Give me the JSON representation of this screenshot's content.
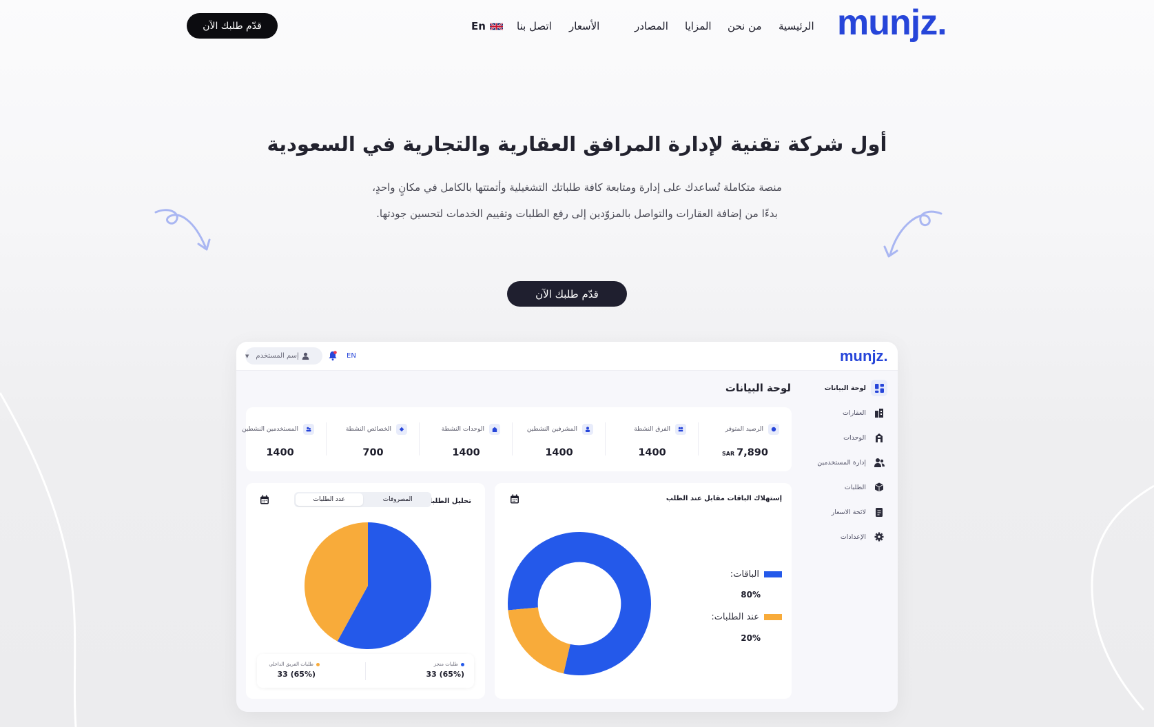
{
  "nav": {
    "logo_text": "munjz.",
    "items": [
      "الرئيسية",
      "من نحن",
      "المزايا",
      "المصادر",
      "الأسعار",
      "اتصل بنا"
    ],
    "lang_label": "En",
    "cta": "قدّم طلبك الآن"
  },
  "hero": {
    "title": "أول شركة تقنية لإدارة المرافق العقارية والتجارية في السعودية",
    "sub1": "منصة  متكاملة تُساعدك على إدارة ومتابعة كافة طلباتك التشغيلية وأتمتتها بالكامل في مكانٍ واحدٍ،",
    "sub2": "بدءًا من إضافة العقارات والتواصل بالمزوّدين إلى رفع الطلبات وتقييم الخدمات لتحسين جودتها.",
    "cta": "قدّم طلبك الآن"
  },
  "dashboard": {
    "logo_text": "munjz.",
    "lang": "EN",
    "user_placeholder": "إسم المستخدم",
    "page_title": "لوحة البيانات",
    "sidebar": [
      {
        "label": "لوحة البيانات",
        "icon": "dashboard-icon",
        "active": true
      },
      {
        "label": "العقارات",
        "icon": "buildings-icon",
        "active": false
      },
      {
        "label": "الوحدات",
        "icon": "building-icon",
        "active": false
      },
      {
        "label": "إدارة المستخدمين",
        "icon": "users-icon",
        "active": false
      },
      {
        "label": "الطلبات",
        "icon": "box-icon",
        "active": false
      },
      {
        "label": "لائحة الاسعار",
        "icon": "price-list-icon",
        "active": false
      },
      {
        "label": "الإعدادات",
        "icon": "gear-icon",
        "active": false
      }
    ],
    "stats": [
      {
        "label": "الرصيد المتوفر",
        "value": "7,890",
        "unit": "SAR",
        "icon": "wallet-icon"
      },
      {
        "label": "الفرق النشطة",
        "value": "1400",
        "unit": "",
        "icon": "team-icon"
      },
      {
        "label": "المشرفين النشطين",
        "value": "1400",
        "unit": "",
        "icon": "supervisor-icon"
      },
      {
        "label": "الوحدات النشطة",
        "value": "1400",
        "unit": "",
        "icon": "home-icon"
      },
      {
        "label": "الخصائص النشطة",
        "value": "700",
        "unit": "",
        "icon": "property-icon"
      },
      {
        "label": "المستخدمين النشطين",
        "value": "1400",
        "unit": "",
        "icon": "active-users-icon"
      }
    ],
    "packages_card": {
      "title": "إستهلاك الباقات مقابل عند الطلب",
      "legend": [
        {
          "label": "الباقات:",
          "value": "80%",
          "color": "#2459ea"
        },
        {
          "label": "عند الطلبات:",
          "value": "20%",
          "color": "#f8ab3a"
        }
      ]
    },
    "requests_card": {
      "title": "تحليل الطلبات",
      "tabs": [
        "المصروفات",
        "عدد الطلبات"
      ],
      "active_tab": 1,
      "legend": [
        {
          "label": "طلبات منجز",
          "value": "33 (65%)",
          "color": "#2459ea"
        },
        {
          "label": "طلبات الفريق الداخلي",
          "value": "33 (65%)",
          "color": "#f8ab3a"
        }
      ]
    }
  },
  "chart_data": [
    {
      "type": "pie",
      "variant": "donut",
      "categories": [
        "الباقات",
        "عند الطلبات"
      ],
      "values": [
        80,
        20
      ],
      "colors": [
        "#2459ea",
        "#f8ab3a"
      ],
      "title": "إستهلاك الباقات مقابل عند الطلب"
    },
    {
      "type": "pie",
      "categories": [
        "طلبات منجز",
        "طلبات الفريق الداخلي"
      ],
      "values": [
        58,
        42
      ],
      "colors": [
        "#2459ea",
        "#f8ab3a"
      ],
      "title": "تحليل الطلبات"
    }
  ]
}
